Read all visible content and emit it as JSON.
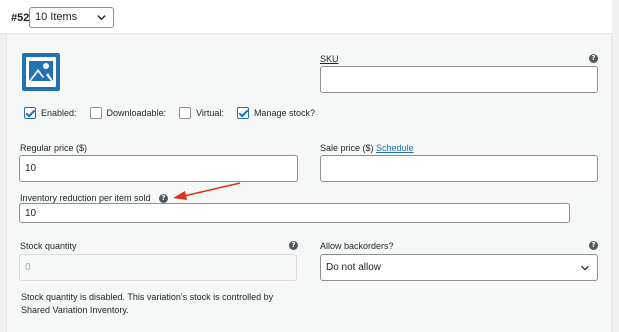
{
  "variation": {
    "number": "#52",
    "selected": "10 Items"
  },
  "sku": {
    "label": "SKU",
    "value": ""
  },
  "checkboxes": [
    {
      "label": "Enabled:",
      "checked": true
    },
    {
      "label": "Downloadable:",
      "checked": false
    },
    {
      "label": "Virtual:",
      "checked": false
    },
    {
      "label": "Manage stock?",
      "checked": true
    }
  ],
  "regular_price": {
    "label": "Regular price ($)",
    "value": "10"
  },
  "sale_price": {
    "label": "Sale price ($)",
    "link": "Schedule",
    "value": ""
  },
  "inventory_reduction": {
    "label": "Inventory reduction per item sold",
    "value": "10"
  },
  "stock_quantity": {
    "label": "Stock quantity",
    "value": "0"
  },
  "backorders": {
    "label": "Allow backorders?",
    "selected": "Do not allow"
  },
  "note": "Stock quantity is disabled. This variation's stock is controlled by Shared Variation Inventory.",
  "icons": {
    "help": "help-icon",
    "image": "image-placeholder-icon",
    "arrow": "annotation-arrow"
  },
  "colors": {
    "accent": "#2271b1",
    "arrow": "#e0321b"
  }
}
